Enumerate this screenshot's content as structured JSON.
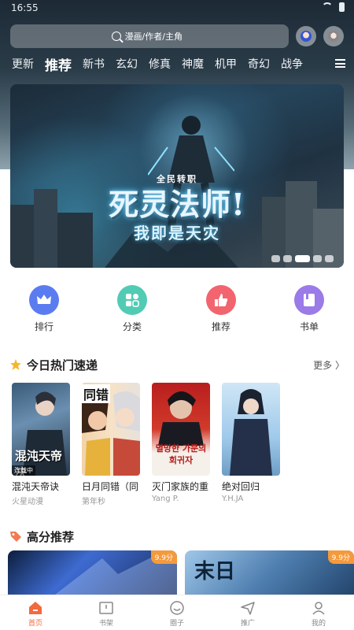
{
  "status": {
    "time": "16:55"
  },
  "search": {
    "placeholder": "漫画/作者/主角"
  },
  "categories": [
    "更新",
    "推荐",
    "新书",
    "玄幻",
    "修真",
    "神魔",
    "机甲",
    "奇幻",
    "战争"
  ],
  "active_category": "推荐",
  "banner": {
    "small_title": "全民转职",
    "title": "死灵法师!",
    "subtitle": "我即是天灾",
    "page_count": 5,
    "active_page": 3
  },
  "quick_entries": [
    {
      "label": "排行",
      "icon": "crown-icon",
      "color": "#5b7cf0"
    },
    {
      "label": "分类",
      "icon": "category-icon",
      "color": "#52cbb5"
    },
    {
      "label": "推荐",
      "icon": "thumbs-up-icon",
      "color": "#f2646e"
    },
    {
      "label": "书单",
      "icon": "book-icon",
      "color": "#9a7be8"
    }
  ],
  "hot_section": {
    "title": "今日热门速递",
    "more": "更多 〉",
    "items": [
      {
        "title": "混沌天帝诀",
        "author": "火星动漫",
        "cover_text": "混沌天帝决",
        "cover_badge": "连载中"
      },
      {
        "title": "日月同错（同",
        "author": "第年秒",
        "cover_text": "同错"
      },
      {
        "title": "灭门家族的重",
        "author": "Yang P.",
        "cover_text": "멸망한 가문의 회귀자"
      },
      {
        "title": "绝对回归",
        "author": "Y.H.JA"
      }
    ]
  },
  "recommend_section": {
    "title": "高分推荐",
    "items": [
      {
        "score": "9.9分"
      },
      {
        "score": "9.9分",
        "cover_text": "末日"
      }
    ]
  },
  "bottom_nav": [
    {
      "label": "首页",
      "icon": "home-icon",
      "active": true
    },
    {
      "label": "书架",
      "icon": "bookshelf-icon",
      "active": false
    },
    {
      "label": "圈子",
      "icon": "circle-icon",
      "active": false
    },
    {
      "label": "推广",
      "icon": "send-icon",
      "active": false
    },
    {
      "label": "我的",
      "icon": "profile-icon",
      "active": false
    }
  ],
  "colors": {
    "accent": "#f26a3d",
    "score_badge": "#f59a3c"
  }
}
